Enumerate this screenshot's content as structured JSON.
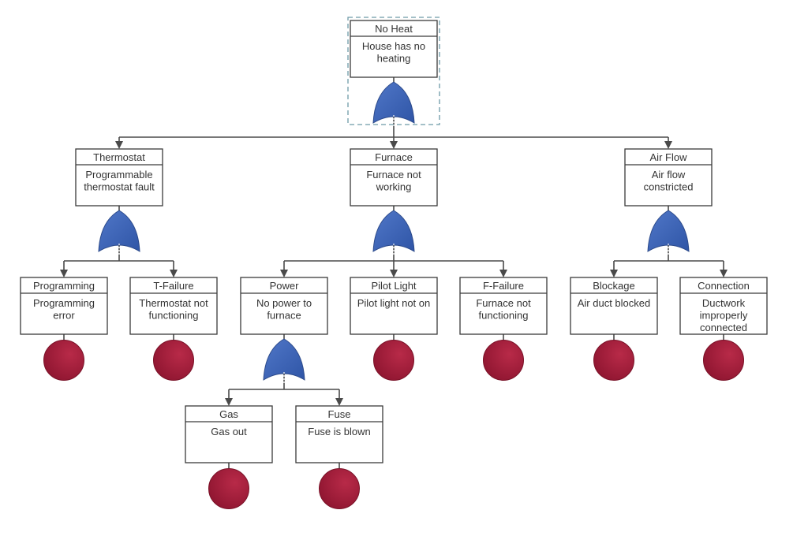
{
  "diagram": {
    "type": "fault-tree",
    "colors": {
      "or_gate": "#3f66b8",
      "basic_event": "#a31c3a",
      "line": "#4a4a4a",
      "selection": "#6e9aa8"
    },
    "selected_node": "no-heat",
    "nodes": [
      {
        "id": "no-heat",
        "title": "No Heat",
        "desc": [
          "House has no",
          "heating"
        ],
        "parent": null,
        "gate": "or"
      },
      {
        "id": "thermostat",
        "title": "Thermostat",
        "desc": [
          "Programmable",
          "thermostat fault"
        ],
        "parent": "no-heat",
        "gate": "or"
      },
      {
        "id": "furnace",
        "title": "Furnace",
        "desc": [
          "Furnace not",
          "working"
        ],
        "parent": "no-heat",
        "gate": "or"
      },
      {
        "id": "air-flow",
        "title": "Air Flow",
        "desc": [
          "Air flow",
          "constricted"
        ],
        "parent": "no-heat",
        "gate": "or"
      },
      {
        "id": "programming",
        "title": "Programming",
        "desc": [
          "Programming",
          "error"
        ],
        "parent": "thermostat",
        "gate": "basic"
      },
      {
        "id": "t-failure",
        "title": "T-Failure",
        "desc": [
          "Thermostat not",
          "functioning"
        ],
        "parent": "thermostat",
        "gate": "basic"
      },
      {
        "id": "power",
        "title": "Power",
        "desc": [
          "No power to",
          "furnace"
        ],
        "parent": "furnace",
        "gate": "or"
      },
      {
        "id": "pilot-light",
        "title": "Pilot Light",
        "desc": [
          "Pilot light not on"
        ],
        "parent": "furnace",
        "gate": "basic"
      },
      {
        "id": "f-failure",
        "title": "F-Failure",
        "desc": [
          "Furnace not",
          "functioning"
        ],
        "parent": "furnace",
        "gate": "basic"
      },
      {
        "id": "blockage",
        "title": "Blockage",
        "desc": [
          "Air duct blocked"
        ],
        "parent": "air-flow",
        "gate": "basic"
      },
      {
        "id": "connection",
        "title": "Connection",
        "desc": [
          "Ductwork",
          "improperly",
          "connected"
        ],
        "parent": "air-flow",
        "gate": "basic"
      },
      {
        "id": "gas",
        "title": "Gas",
        "desc": [
          "Gas out"
        ],
        "parent": "power",
        "gate": "basic"
      },
      {
        "id": "fuse",
        "title": "Fuse",
        "desc": [
          "Fuse is blown"
        ],
        "parent": "power",
        "gate": "basic"
      }
    ]
  }
}
